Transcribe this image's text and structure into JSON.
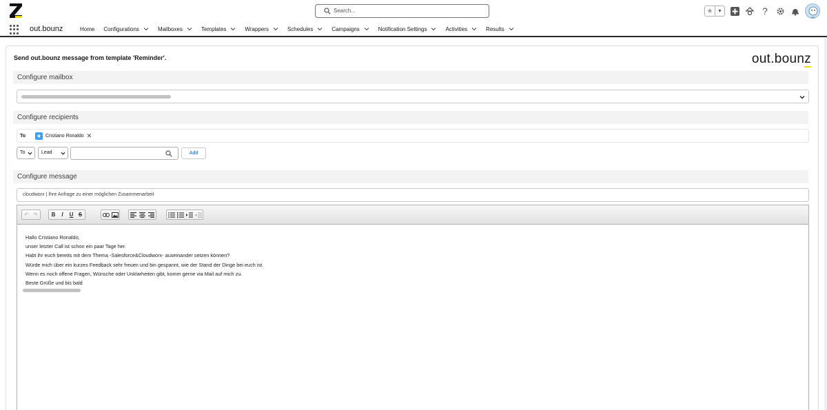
{
  "header": {
    "search_placeholder": "Search..."
  },
  "nav": {
    "app_name": "out.bounz",
    "items": [
      {
        "label": "Home",
        "has_menu": false
      },
      {
        "label": "Configurations",
        "has_menu": true
      },
      {
        "label": "Mailboxes",
        "has_menu": true
      },
      {
        "label": "Templates",
        "has_menu": true
      },
      {
        "label": "Wrappers",
        "has_menu": true
      },
      {
        "label": "Schedules",
        "has_menu": true
      },
      {
        "label": "Campaigns",
        "has_menu": true
      },
      {
        "label": "Notification Settings",
        "has_menu": true
      },
      {
        "label": "Activities",
        "has_menu": true
      },
      {
        "label": "Results",
        "has_menu": true
      }
    ]
  },
  "card": {
    "title": "Send out.bounz message from template 'Reminder'.",
    "brand_main": "out.boun",
    "brand_z": "z"
  },
  "sections": {
    "mailbox": "Configure mailbox",
    "recipients": "Configure recipients",
    "message": "Configure message"
  },
  "recipients": {
    "to_label": "To",
    "pill_name": "Cristiano Ronaldo",
    "pill_remove": "✕",
    "type_select": "To",
    "object_select": "Lead",
    "add_button": "Add"
  },
  "message": {
    "subject": "cloudworx | Ihre Anfrage zu einer möglichen Zusammenarbeit",
    "body_lines": [
      "Hallo Cristiano Ronaldo,",
      "unser letzter Call ist schon ein paar Tage her.",
      "Habt ihr euch bereits mit dem Thema -Salesforce&Cloudworx- auseinander setzen können?",
      "Würde mich über ein kurzes Feedback sehr freuen und bin gespannt, wie der Stand der Dinge bei euch ist.",
      "Wenn es noch offene Fragen, Wünsche oder Unklarheiten gibt, komm gerne via Mail auf mich zu.",
      "Beste Grüße und bis bald"
    ]
  },
  "colors": {
    "brand_accent": "#f5d90a",
    "lead_icon": "#3ba1f2",
    "link_blue": "#0b5cab"
  },
  "icons": [
    "z-logo-icon",
    "search-icon",
    "favorites-star-icon",
    "favorites-dropdown-icon",
    "global-actions-add-icon",
    "trailhead-icon",
    "help-icon",
    "setup-gear-icon",
    "notifications-bell-icon",
    "user-avatar-icon",
    "app-launcher-icon",
    "chevron-down-icon",
    "lead-icon"
  ]
}
